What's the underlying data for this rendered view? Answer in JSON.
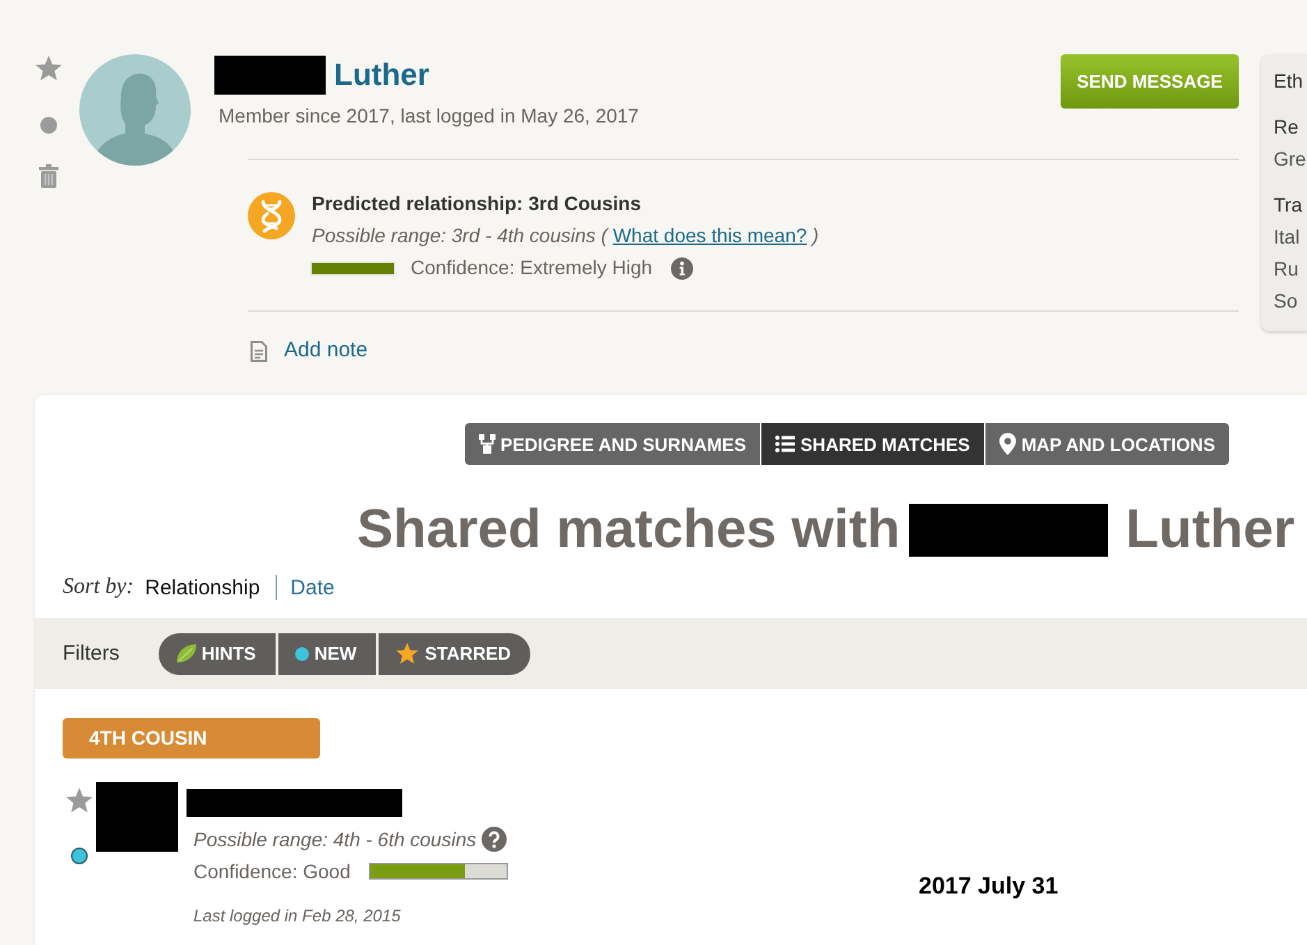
{
  "actions": {
    "starred": false,
    "new": false
  },
  "profile": {
    "surname": "Luther",
    "member_info": "Member since 2017, last logged in May 26, 2017",
    "send_button": "SEND MESSAGE"
  },
  "relationship": {
    "predicted": "Predicted relationship: 3rd Cousins",
    "range_text": "Possible range: 3rd - 4th cousins (",
    "range_link": "What does this mean?",
    "range_close": ")",
    "confidence": {
      "label": "Confidence: Extremely High",
      "level": 1
    }
  },
  "add_note": "Add note",
  "ethnicity_panel": {
    "title": "Eth",
    "sections": [
      {
        "heading": "Re",
        "items": [
          "Gre"
        ]
      },
      {
        "heading": "Tra",
        "items": [
          "Ital",
          "Ru",
          "So"
        ]
      }
    ]
  },
  "tabs": [
    {
      "label": "PEDIGREE AND SURNAMES",
      "kind": "pedigree",
      "selected": false
    },
    {
      "label": "SHARED MATCHES",
      "kind": "list",
      "selected": true
    },
    {
      "label": "MAP AND LOCATIONS",
      "kind": "map",
      "selected": false
    }
  ],
  "heading": {
    "prefix": "Shared matches with",
    "surname": "Luther"
  },
  "sort": {
    "label": "Sort by:",
    "options": [
      {
        "label": "Relationship",
        "selected": true
      },
      {
        "label": "Date",
        "selected": false
      }
    ]
  },
  "filters": {
    "label": "Filters",
    "items": [
      {
        "label": "HINTS",
        "kind": "hints",
        "selected": false
      },
      {
        "label": "NEW",
        "kind": "new",
        "selected": false
      },
      {
        "label": "STARRED",
        "kind": "starred",
        "selected": false
      }
    ]
  },
  "groups": [
    {
      "label": "4TH COUSIN",
      "matches": [
        {
          "starred": false,
          "new": true,
          "range": "Possible range: 4th - 6th cousins",
          "confidence": {
            "label": "Confidence: Good",
            "level": 0.7
          },
          "last_logged": "Last logged in Feb 28, 2015"
        }
      ]
    }
  ],
  "annotation": "2017 July 31"
}
